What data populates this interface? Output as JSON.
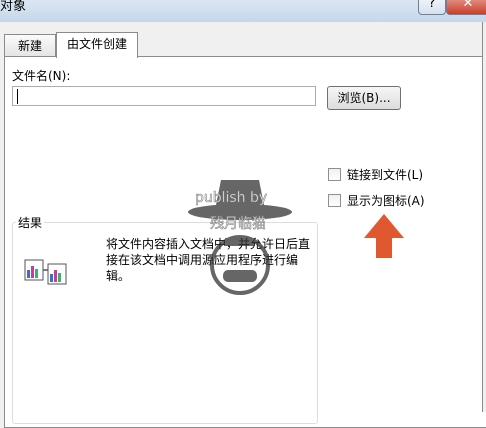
{
  "window": {
    "title": "对象",
    "help_symbol": "?",
    "close_symbol": "✕"
  },
  "tabs": [
    {
      "label": "新建",
      "active": false
    },
    {
      "label": "由文件创建",
      "active": true
    }
  ],
  "file": {
    "label": "文件名(N):",
    "value": "",
    "browse_label": "浏览(B)..."
  },
  "options": {
    "link_label": "链接到文件(L)",
    "link_checked": false,
    "icon_label": "显示为图标(A)",
    "icon_checked": false
  },
  "result": {
    "label": "结果",
    "text": "将文件内容插入文档中，并允许日后直接在该文档中调用源应用程序进行编辑。"
  },
  "watermark": {
    "line1": "publish by",
    "line2": "残月临猫"
  },
  "colors": {
    "arrow": "#e0582f",
    "accent": "#c6d7ea"
  }
}
